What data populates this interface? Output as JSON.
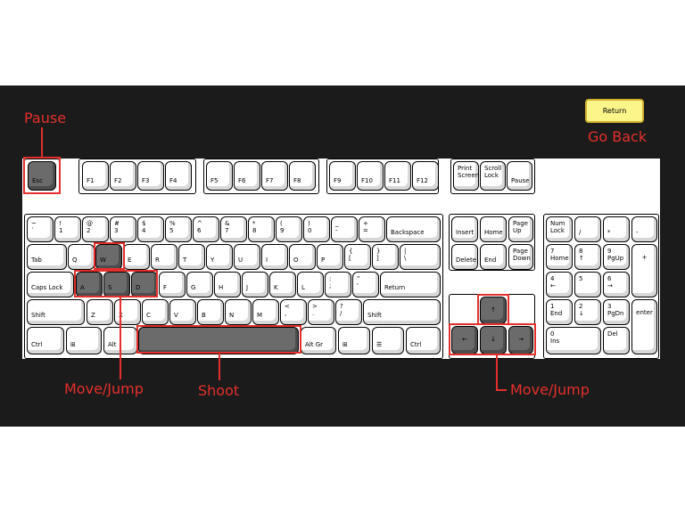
{
  "return_button": "Return",
  "labels": {
    "pause": "Pause",
    "go_back": "Go Back",
    "move_jump_left": "Move/Jump",
    "shoot": "Shoot",
    "move_jump_right": "Move/Jump"
  },
  "colors": {
    "background": "#1b1b1b",
    "accent": "#e4302c",
    "highlight_key": "#6b6b6b",
    "return_button": "#fbf58a"
  },
  "keys": {
    "esc": "Esc",
    "f1": "F1",
    "f2": "F2",
    "f3": "F3",
    "f4": "F4",
    "f5": "F5",
    "f6": "F6",
    "f7": "F7",
    "f8": "F8",
    "f9": "F9",
    "f10": "F10",
    "f11": "F11",
    "f12": "F12",
    "print_screen": [
      "Print",
      "Screen"
    ],
    "scroll_lock": [
      "Scroll",
      "Lock"
    ],
    "pause": "Pause",
    "backtick": [
      "~",
      "`"
    ],
    "digit1": [
      "!",
      "1"
    ],
    "digit2": [
      "@",
      "2"
    ],
    "digit3": [
      "#",
      "3"
    ],
    "digit4": [
      "$",
      "4"
    ],
    "digit5": [
      "%",
      "5"
    ],
    "digit6": [
      "^",
      "6"
    ],
    "digit7": [
      "&",
      "7"
    ],
    "digit8": [
      "*",
      "8"
    ],
    "digit9": [
      "(",
      "9"
    ],
    "digit0": [
      ")",
      "0"
    ],
    "minus": [
      "_",
      "-"
    ],
    "equal": [
      "+",
      "="
    ],
    "backspace": "Backspace",
    "tab": "Tab",
    "q": "Q",
    "w": "W",
    "e": "E",
    "r": "R",
    "t": "T",
    "y": "Y",
    "u": "U",
    "i": "I",
    "o": "O",
    "p": "P",
    "bracket_left": [
      "{",
      "["
    ],
    "bracket_right": [
      "}",
      "]"
    ],
    "backslash": [
      "|",
      "\\"
    ],
    "caps_lock": "Caps Lock",
    "a": "A",
    "s": "S",
    "d": "D",
    "f": "F",
    "g": "G",
    "h": "H",
    "j": "J",
    "k": "K",
    "l": "L",
    "semicolon": [
      ":",
      ";"
    ],
    "quote": [
      "\"",
      "'"
    ],
    "return": "Return",
    "shift_left": "Shift",
    "z": "Z",
    "x": "X",
    "c": "C",
    "v": "V",
    "b": "B",
    "n": "N",
    "m": "M",
    "comma": [
      "<",
      ","
    ],
    "period": [
      ">",
      "."
    ],
    "slash": [
      "?",
      "/"
    ],
    "shift_right": "Shift",
    "ctrl_left": "Ctrl",
    "win_left": "⊞",
    "alt": "Alt",
    "alt_gr": "Alt Gr",
    "win_right": "⊞",
    "menu": "☰",
    "ctrl_right": "Ctrl",
    "insert": "Insert",
    "home": "Home",
    "page_up": [
      "Page",
      "Up"
    ],
    "delete": "Delete",
    "end": "End",
    "page_down": [
      "Page",
      "Down"
    ],
    "arrow_up": "↑",
    "arrow_left": "←",
    "arrow_down": "↓",
    "arrow_right": "→",
    "num_lock": [
      "Num",
      "Lock"
    ],
    "num_divide": "/",
    "num_multiply": "*",
    "num_minus": "-",
    "num7": [
      "7",
      "Home"
    ],
    "num8": [
      "8",
      "↑"
    ],
    "num9": [
      "9",
      "PgUp"
    ],
    "num_plus": "+",
    "num4": [
      "4",
      "←"
    ],
    "num5": "5",
    "num6": [
      "6",
      "→"
    ],
    "num1": [
      "1",
      "End"
    ],
    "num2": [
      "2",
      "↓"
    ],
    "num3": [
      "3",
      "PgDn"
    ],
    "num_enter": "enter",
    "num0": [
      "0",
      "Ins"
    ],
    "num_decimal": [
      "",
      "Del"
    ]
  },
  "highlighted": [
    "esc",
    "w",
    "a",
    "s",
    "d",
    "space",
    "arrow_up",
    "arrow_left",
    "arrow_down",
    "arrow_right"
  ]
}
